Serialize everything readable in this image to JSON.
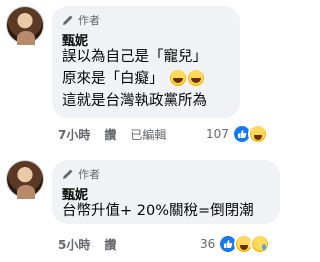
{
  "comments": [
    {
      "badge": "作者",
      "author": "甄妮",
      "lines": [
        "誤以為自己是「寵兒」",
        "原來是「白癡」",
        "這就是台灣執政黨所為"
      ],
      "time": "7小時",
      "action": "讚",
      "edited": "已編輯",
      "reaction_count": "107",
      "reaction_icons": [
        "like-icon",
        "haha-icon"
      ]
    },
    {
      "badge": "作者",
      "author": "甄妮",
      "lines": [
        "台幣升值+ 20%關稅=倒閉潮"
      ],
      "time": "5小時",
      "action": "讚",
      "reaction_count": "36",
      "reaction_icons": [
        "like-icon",
        "haha-icon",
        "sad-icon"
      ]
    }
  ],
  "colors": {
    "bubble": "#f0f2f5",
    "secondary_text": "#65676b",
    "like_blue": "#1877f2"
  }
}
